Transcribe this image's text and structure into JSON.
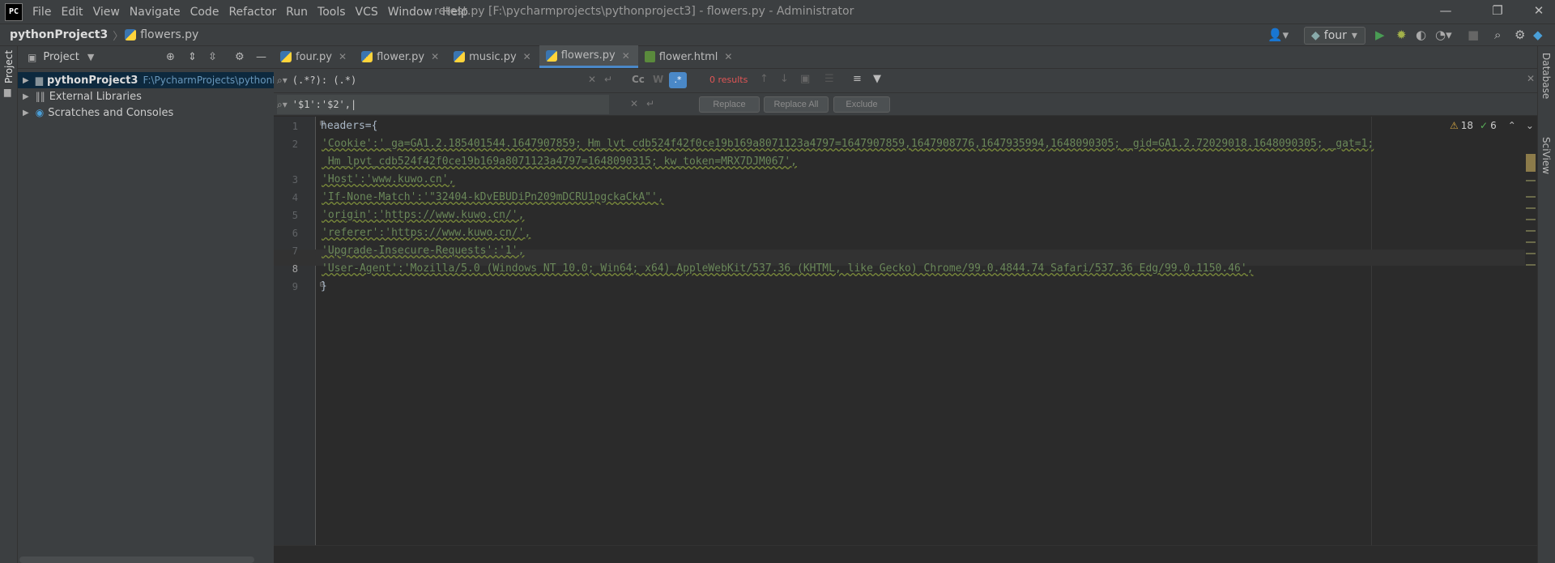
{
  "menubar": {
    "logo": "PC",
    "items": [
      "File",
      "Edit",
      "View",
      "Navigate",
      "Code",
      "Refactor",
      "Run",
      "Tools",
      "VCS",
      "Window",
      "Help"
    ],
    "window_title": "retest.py [F:\\pycharmprojects\\pythonproject3] - flowers.py - Administrator"
  },
  "navbar": {
    "project": "pythonProject3",
    "file": "flowers.py",
    "run_config": "four"
  },
  "left_strip": {
    "label": "Project"
  },
  "right_strip": {
    "database": "Database",
    "sciview": "SciView"
  },
  "project_panel": {
    "title": "Project",
    "tree": [
      {
        "name": "pythonProject3",
        "path": "F:\\PycharmProjects\\pythonPro"
      },
      {
        "name": "External Libraries"
      },
      {
        "name": "Scratches and Consoles"
      }
    ]
  },
  "tabs": [
    {
      "label": "four.py",
      "type": "py",
      "active": false
    },
    {
      "label": "flower.py",
      "type": "py",
      "active": false
    },
    {
      "label": "music.py",
      "type": "py",
      "active": false
    },
    {
      "label": "flowers.py",
      "type": "py",
      "active": true
    },
    {
      "label": "flower.html",
      "type": "html",
      "active": false
    }
  ],
  "find": {
    "search_value": "(.*?): (.*)",
    "replace_value": "'$1':'$2',",
    "results": "0 results",
    "match_case": "Cc",
    "words": "W",
    "regex": ".*",
    "replace_label": "Replace",
    "replace_all_label": "Replace All",
    "exclude_label": "Exclude"
  },
  "inspections": {
    "warnings": "18",
    "weak_warnings": "6"
  },
  "code_lines": [
    {
      "num": "1",
      "text": "headers={"
    },
    {
      "num": "2",
      "text": "'Cookie':'_ga=GA1.2.185401544.1647907859; Hm_lvt_cdb524f42f0ce19b169a8071123a4797=1647907859,1647908776,1647935994,1648090305; _gid=GA1.2.72029018.1648090305; _gat=1;"
    },
    {
      "num": "",
      "text": " Hm_lpvt_cdb524f42f0ce19b169a8071123a4797=1648090315; kw_token=MRX7DJM067',"
    },
    {
      "num": "3",
      "text": "'Host':'www.kuwo.cn',"
    },
    {
      "num": "4",
      "text": "'If-None-Match':'\"32404-kDvEBUDiPn209mDCRU1pgckaCkA\"',"
    },
    {
      "num": "5",
      "text": "'origin':'https://www.kuwo.cn/',"
    },
    {
      "num": "6",
      "text": "'referer':'https://www.kuwo.cn/',"
    },
    {
      "num": "7",
      "text": "'Upgrade-Insecure-Requests':'1',"
    },
    {
      "num": "8",
      "text": "'User-Agent':'Mozilla/5.0 (Windows NT 10.0; Win64; x64) AppleWebKit/537.36 (KHTML, like Gecko) Chrome/99.0.4844.74 Safari/537.36 Edg/99.0.1150.46',"
    },
    {
      "num": "9",
      "text": "}"
    }
  ],
  "colors": {
    "accent": "#4a88c7",
    "string": "#6a8759",
    "results": "#e05555",
    "run": "#499c54"
  }
}
